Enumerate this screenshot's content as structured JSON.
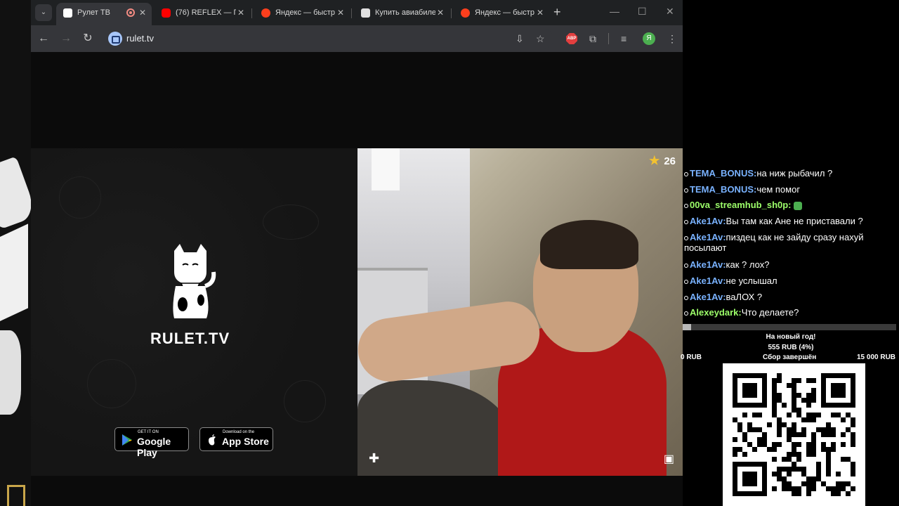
{
  "browser": {
    "tabs": [
      {
        "label": "Рулет ТВ",
        "active": true,
        "favicon": "rulet-favicon",
        "recording": true
      },
      {
        "label": "(76) REFLEX — П",
        "favicon": "youtube-favicon"
      },
      {
        "label": "Яндекс — быстр",
        "favicon": "yandex-favicon"
      },
      {
        "label": "Купить авиабиле",
        "favicon": "aviasales-favicon"
      },
      {
        "label": "Яндекс — быстр",
        "favicon": "yandex-favicon"
      }
    ],
    "new_tab": "+",
    "window_controls": {
      "minimize": "—",
      "maximize": "☐",
      "close": "✕"
    },
    "url": "rulet.tv",
    "profile_initial": "Я",
    "abp_label": "ABP"
  },
  "page": {
    "brand": "RULET.TV",
    "google_play": {
      "small": "GET IT ON",
      "big": "Google Play"
    },
    "app_store": {
      "small": "Download on the",
      "big": "App Store"
    },
    "rating": "26"
  },
  "chat": [
    {
      "user": "TEMA_BONUS:",
      "text": "на ниж рыбачил ?",
      "color": "blue"
    },
    {
      "user": "TEMA_BONUS:",
      "text": "чем помог",
      "color": "blue"
    },
    {
      "user": "00va_streamhub_sh0p:",
      "text": "",
      "color": "green",
      "emote": true
    },
    {
      "user": "Ake1Av:",
      "text": "Вы там как Ане не приставали ?",
      "color": "blue"
    },
    {
      "user": "Ake1Av:",
      "text": "пиздец как не зайду сразу нахуй посылают",
      "color": "blue"
    },
    {
      "user": "Ake1Av:",
      "text": "как ? лох?",
      "color": "blue"
    },
    {
      "user": "Ake1Av:",
      "text": "не услышал",
      "color": "blue"
    },
    {
      "user": "Ake1Av:",
      "text": "ваЛОХ ?",
      "color": "blue"
    },
    {
      "user": "Alexeydark:",
      "text": "Что делаете?",
      "color": "green"
    }
  ],
  "donation_goal": {
    "title": "На новый год!",
    "current": "555 RUB (4%)",
    "progress": 0.04,
    "min": "0 RUB",
    "status": "Сбор завершён",
    "max": "15 000 RUB"
  }
}
